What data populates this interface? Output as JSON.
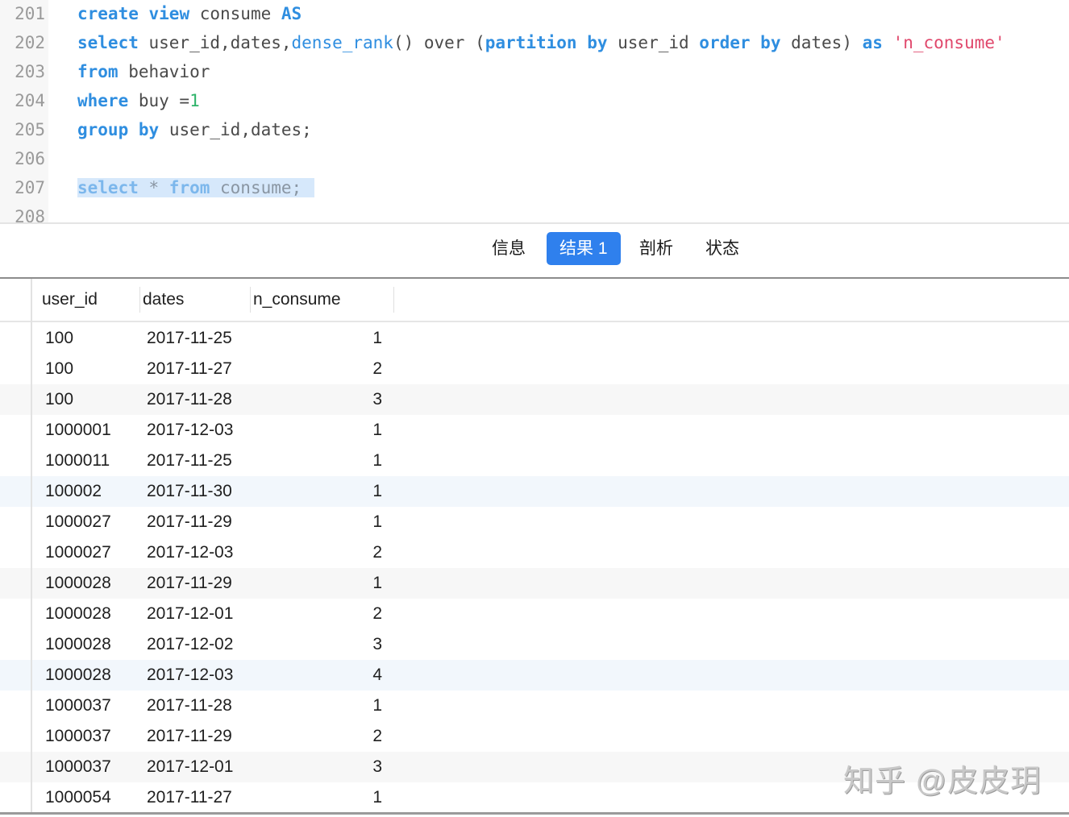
{
  "editor": {
    "lines": [
      {
        "num": "201",
        "tokens": [
          [
            "kw",
            "create"
          ],
          [
            "p",
            " "
          ],
          [
            "kw",
            "view"
          ],
          [
            "p",
            " consume "
          ],
          [
            "kw",
            "AS"
          ]
        ]
      },
      {
        "num": "202",
        "tokens": [
          [
            "kw",
            "select"
          ],
          [
            "p",
            " user_id,dates,"
          ],
          [
            "fn",
            "dense_rank"
          ],
          [
            "p",
            "() over ("
          ],
          [
            "kw",
            "partition"
          ],
          [
            "p",
            " "
          ],
          [
            "kw",
            "by"
          ],
          [
            "p",
            " user_id "
          ],
          [
            "kw",
            "order"
          ],
          [
            "p",
            " "
          ],
          [
            "kw",
            "by"
          ],
          [
            "p",
            " dates) "
          ],
          [
            "kw",
            "as"
          ],
          [
            "p",
            " "
          ],
          [
            "str",
            "'n_consume'"
          ]
        ]
      },
      {
        "num": "203",
        "tokens": [
          [
            "kw",
            "from"
          ],
          [
            "p",
            " behavior"
          ]
        ]
      },
      {
        "num": "204",
        "tokens": [
          [
            "kw",
            "where"
          ],
          [
            "p",
            " buy ="
          ],
          [
            "num",
            "1"
          ]
        ]
      },
      {
        "num": "205",
        "tokens": [
          [
            "kw",
            "group"
          ],
          [
            "p",
            " "
          ],
          [
            "kw",
            "by"
          ],
          [
            "p",
            " user_id,dates;"
          ]
        ]
      },
      {
        "num": "206",
        "tokens": []
      },
      {
        "num": "207",
        "selected": true,
        "tokens": [
          [
            "kw",
            "select"
          ],
          [
            "p",
            " * "
          ],
          [
            "kw",
            "from"
          ],
          [
            "p",
            " consume;"
          ]
        ]
      },
      {
        "num": "208",
        "tokens": []
      }
    ]
  },
  "tabs": [
    {
      "label": "信息",
      "active": false
    },
    {
      "label": "结果 1",
      "active": true
    },
    {
      "label": "剖析",
      "active": false
    },
    {
      "label": "状态",
      "active": false
    }
  ],
  "grid": {
    "columns": [
      "user_id",
      "dates",
      "n_consume"
    ],
    "rows": [
      [
        "100",
        "2017-11-25",
        "1"
      ],
      [
        "100",
        "2017-11-27",
        "2"
      ],
      [
        "100",
        "2017-11-28",
        "3"
      ],
      [
        "1000001",
        "2017-12-03",
        "1"
      ],
      [
        "1000011",
        "2017-11-25",
        "1"
      ],
      [
        "100002",
        "2017-11-30",
        "1"
      ],
      [
        "1000027",
        "2017-11-29",
        "1"
      ],
      [
        "1000027",
        "2017-12-03",
        "2"
      ],
      [
        "1000028",
        "2017-11-29",
        "1"
      ],
      [
        "1000028",
        "2017-12-01",
        "2"
      ],
      [
        "1000028",
        "2017-12-02",
        "3"
      ],
      [
        "1000028",
        "2017-12-03",
        "4"
      ],
      [
        "1000037",
        "2017-11-28",
        "1"
      ],
      [
        "1000037",
        "2017-11-29",
        "2"
      ],
      [
        "1000037",
        "2017-12-01",
        "3"
      ],
      [
        "1000054",
        "2017-11-27",
        "1"
      ]
    ]
  },
  "watermark": "知乎 @皮皮玥",
  "colors": {
    "keyword": "#2f8ee0",
    "string": "#e0486c",
    "number": "#2fb36a",
    "active_tab": "#2f80ed",
    "selection": "#d6e8fb"
  }
}
